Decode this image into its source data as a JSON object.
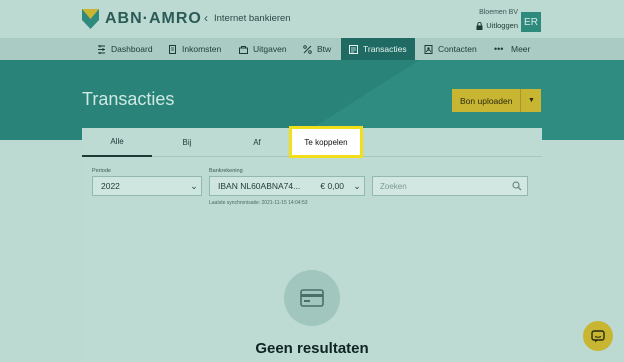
{
  "header": {
    "logo_text": "ABN·AMRO",
    "back_link": "Internet bankieren",
    "company": "Bloemen BV",
    "logout": "Uitloggen",
    "avatar_initials": "ER"
  },
  "nav": {
    "items": [
      {
        "label": "Dashboard",
        "icon": "dashboard-icon"
      },
      {
        "label": "Inkomsten",
        "icon": "document-icon"
      },
      {
        "label": "Uitgaven",
        "icon": "basket-icon"
      },
      {
        "label": "Btw",
        "icon": "btw-icon"
      },
      {
        "label": "Transacties",
        "icon": "transactions-icon",
        "active": true
      },
      {
        "label": "Contacten",
        "icon": "contacts-icon"
      },
      {
        "label": "Meer",
        "icon": "more-icon"
      }
    ]
  },
  "page": {
    "title": "Transacties",
    "upload_button": "Bon uploaden"
  },
  "tabs": [
    {
      "label": "Alle",
      "active": true
    },
    {
      "label": "Bij"
    },
    {
      "label": "Af"
    },
    {
      "label": "Te koppelen",
      "highlighted": true
    }
  ],
  "filters": {
    "period_label": "Periode",
    "period_value": "2022",
    "account_label": "Bankrekening",
    "account_value": "IBAN NL60ABNA74...",
    "account_amount": "€ 0,00",
    "search_placeholder": "Zoeken",
    "last_sync": "Laatste synchronisatie: 2021-11-15 14:04:53"
  },
  "empty_state": {
    "title": "Geen resultaten"
  },
  "colors": {
    "brand_green": "#2a8378",
    "active_nav": "#1f6b63",
    "accent_yellow": "#c8b633",
    "highlight_border": "#f2df1a"
  }
}
